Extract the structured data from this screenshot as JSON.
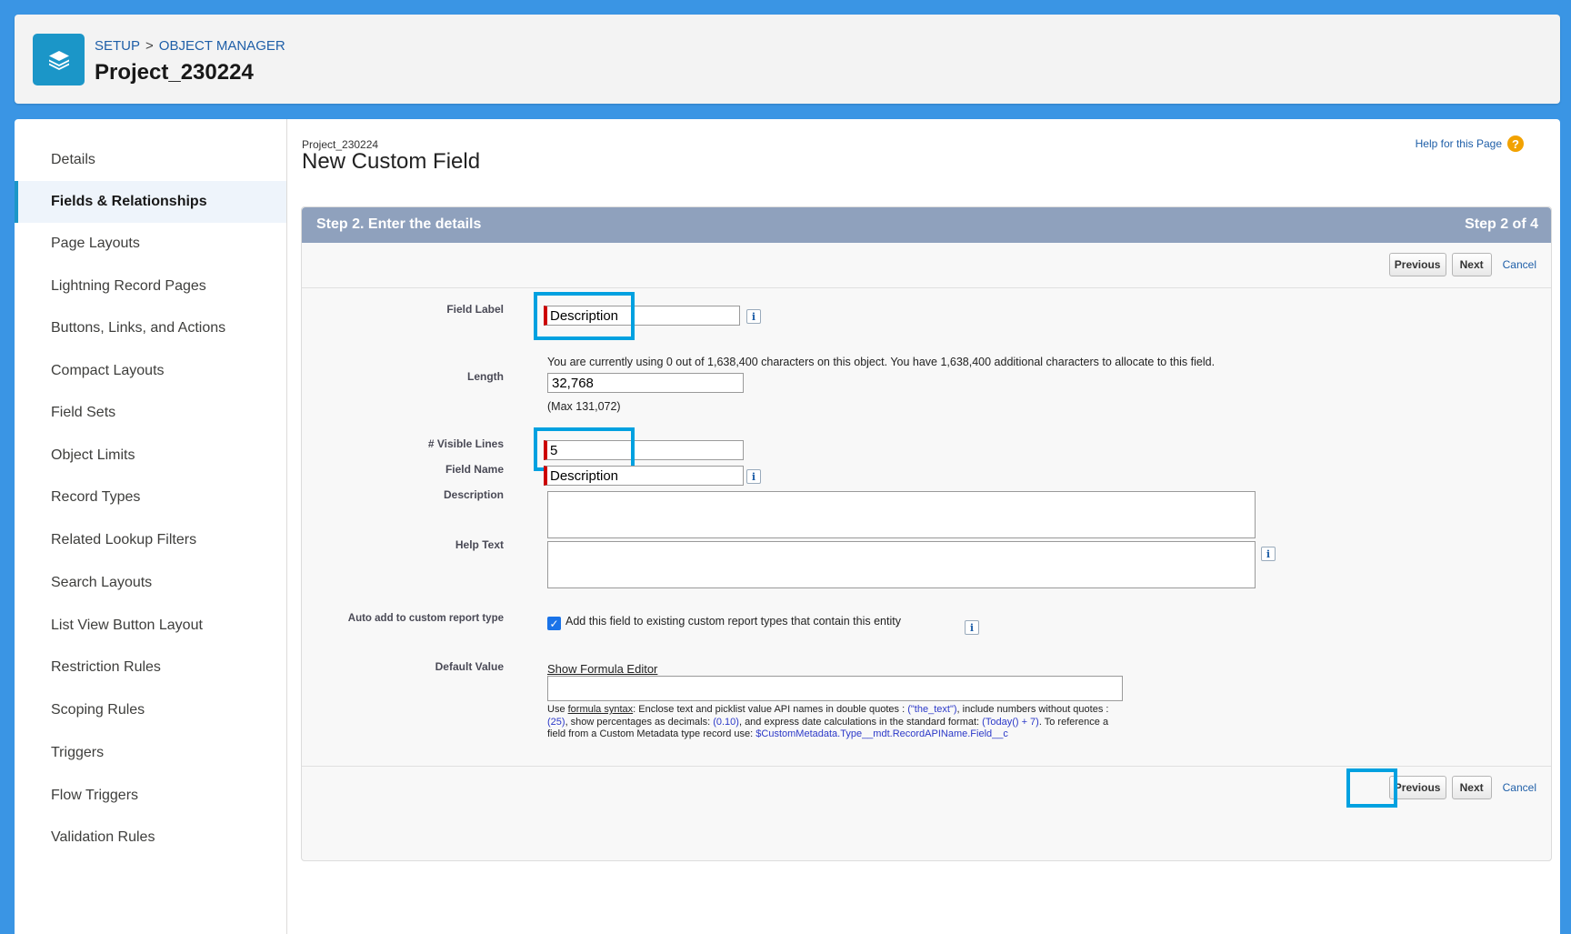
{
  "header": {
    "breadcrumb": [
      "SETUP",
      "OBJECT MANAGER"
    ],
    "breadcrumb_sep": ">",
    "title": "Project_230224",
    "icon": "layers-icon"
  },
  "sidebar": {
    "items": [
      {
        "label": "Details"
      },
      {
        "label": "Fields & Relationships",
        "active": true
      },
      {
        "label": "Page Layouts"
      },
      {
        "label": "Lightning Record Pages"
      },
      {
        "label": "Buttons, Links, and Actions"
      },
      {
        "label": "Compact Layouts"
      },
      {
        "label": "Field Sets"
      },
      {
        "label": "Object Limits"
      },
      {
        "label": "Record Types"
      },
      {
        "label": "Related Lookup Filters"
      },
      {
        "label": "Search Layouts"
      },
      {
        "label": "List View Button Layout"
      },
      {
        "label": "Restriction Rules"
      },
      {
        "label": "Scoping Rules"
      },
      {
        "label": "Triggers"
      },
      {
        "label": "Flow Triggers"
      },
      {
        "label": "Validation Rules"
      }
    ]
  },
  "page": {
    "object_name": "Project_230224",
    "title": "New Custom Field",
    "help_link": "Help for this Page",
    "help_icon": "question-circle-icon"
  },
  "step": {
    "title": "Step 2. Enter the details",
    "count": "Step 2 of 4"
  },
  "buttons": {
    "previous": "Previous",
    "next": "Next",
    "cancel": "Cancel"
  },
  "form": {
    "field_label": {
      "label": "Field Label",
      "value": "Description"
    },
    "usage_note": "You are currently using 0 out of 1,638,400 characters on this object. You have 1,638,400 additional characters to allocate to this field.",
    "length": {
      "label": "Length",
      "value": "32,768",
      "max_note": "(Max 131,072)"
    },
    "visible_lines": {
      "label": "# Visible Lines",
      "value": "5"
    },
    "field_name": {
      "label": "Field Name",
      "value": "Description"
    },
    "description": {
      "label": "Description",
      "value": ""
    },
    "help_text": {
      "label": "Help Text",
      "value": ""
    },
    "auto_add": {
      "label": "Auto add to custom report type",
      "checked": true,
      "text": "Add this field to existing custom report types that contain this entity"
    },
    "default_value": {
      "label": "Default Value",
      "show_formula": "Show Formula Editor",
      "help_use": "Use ",
      "help_syntax": "formula syntax",
      "help_p1": ": Enclose text and picklist value API names in double quotes : ",
      "help_ex1": "(\"the_text\")",
      "help_p2": ", include numbers without quotes : ",
      "help_ex2": "(25)",
      "help_p3": ", show percentages as decimals: ",
      "help_ex3": "(0.10)",
      "help_p4": ", and express date calculations in the standard format: ",
      "help_ex4": "(Today() + 7)",
      "help_p5": ". To reference a field from a Custom Metadata type record use: ",
      "help_ex5": "$CustomMetadata.Type__mdt.RecordAPIName.Field__c"
    }
  },
  "colors": {
    "background": "#3a95e4",
    "step_header": "#8fa1bd",
    "highlight": "#00a1e0",
    "required": "#cc0000",
    "link": "#1f5fa8"
  }
}
